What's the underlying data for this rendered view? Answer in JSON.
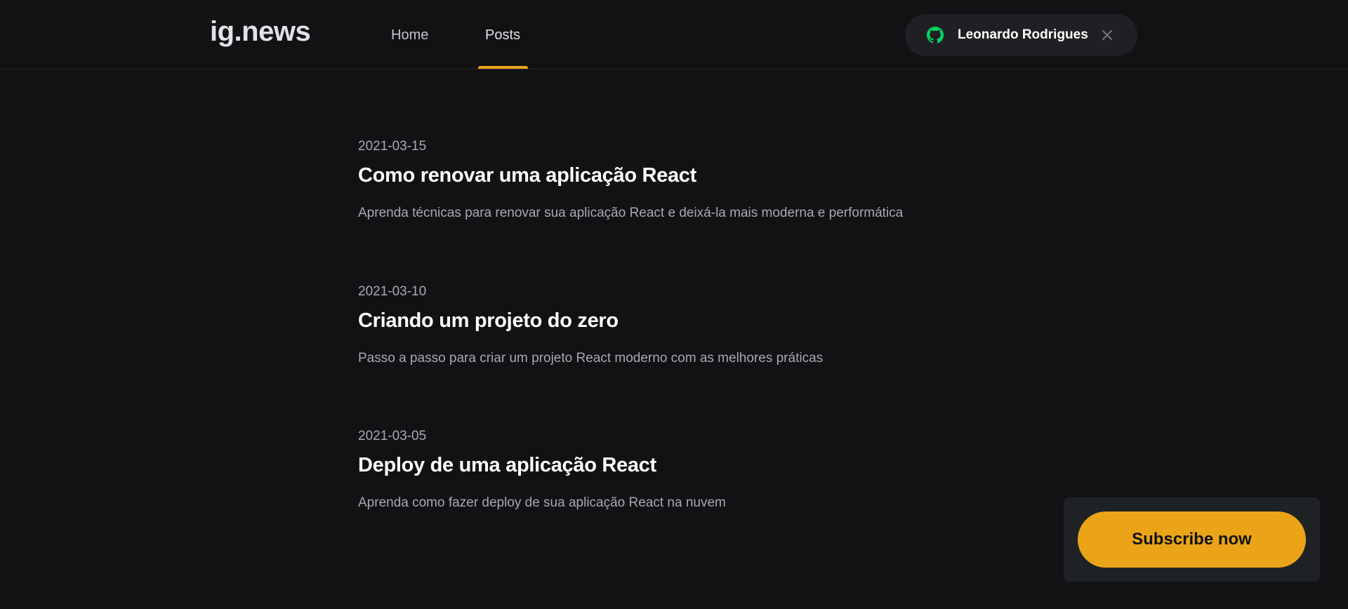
{
  "app": {
    "logo": "ig.news"
  },
  "nav": {
    "items": [
      {
        "label": "Home",
        "active": false
      },
      {
        "label": "Posts",
        "active": true
      }
    ]
  },
  "user": {
    "name": "Leonardo Rodrigues",
    "icon": "github-icon",
    "close_icon": "close-icon"
  },
  "posts": [
    {
      "date": "2021-03-15",
      "title": "Como renovar uma aplicação React",
      "excerpt": "Aprenda técnicas para renovar sua aplicação React e deixá-la mais moderna e performática"
    },
    {
      "date": "2021-03-10",
      "title": "Criando um projeto do zero",
      "excerpt": "Passo a passo para criar um projeto React moderno com as melhores práticas"
    },
    {
      "date": "2021-03-05",
      "title": "Deploy de uma aplicação React",
      "excerpt": "Aprenda como fazer deploy de sua aplicação React na nuvem"
    }
  ],
  "subscribe": {
    "label": "Subscribe now"
  },
  "colors": {
    "background": "#121214",
    "accent": "#eba417",
    "github_green": "#04d361",
    "pill": "#202024",
    "text_muted": "#a8a8b3"
  }
}
